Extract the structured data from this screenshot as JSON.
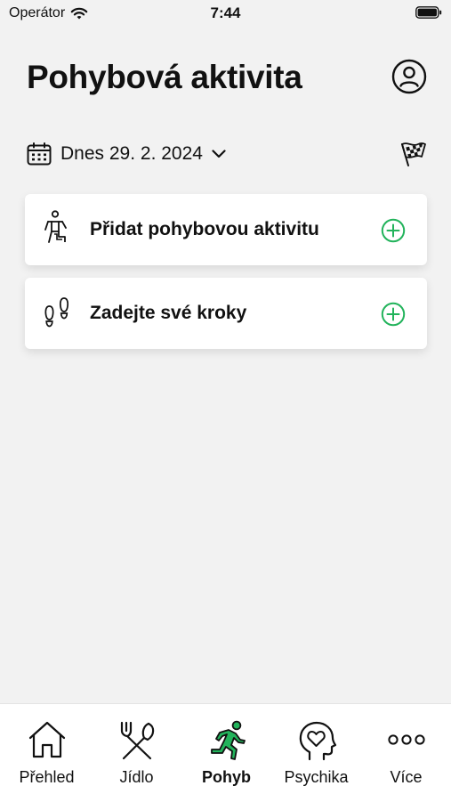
{
  "status_bar": {
    "carrier": "Operátor",
    "time": "7:44"
  },
  "header": {
    "title": "Pohybová aktivita"
  },
  "date_selector": {
    "label": "Dnes 29. 2. 2024"
  },
  "cards": [
    {
      "label": "Přidat pohybovou aktivitu",
      "icon": "person-stepping-icon"
    },
    {
      "label": "Zadejte své kroky",
      "icon": "footprints-icon"
    }
  ],
  "tabs": [
    {
      "label": "Přehled",
      "icon": "home-icon",
      "active": false
    },
    {
      "label": "Jídlo",
      "icon": "fork-knife-icon",
      "active": false
    },
    {
      "label": "Pohyb",
      "icon": "running-person-icon",
      "active": true
    },
    {
      "label": "Psychika",
      "icon": "head-heart-icon",
      "active": false
    },
    {
      "label": "Více",
      "icon": "more-dots-icon",
      "active": false
    }
  ],
  "colors": {
    "accent": "#22b35b",
    "background": "#f2f2f2",
    "card": "#ffffff",
    "text": "#111111"
  }
}
